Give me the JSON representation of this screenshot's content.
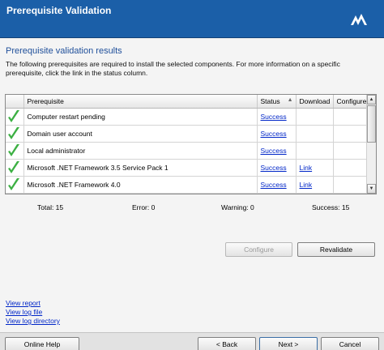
{
  "window": {
    "title": "Prerequisite Validation"
  },
  "section": {
    "title": "Prerequisite validation results",
    "description": "The following prerequisites are required to install the selected components.  For more information on a specific prerequisite, click the link in the status column."
  },
  "grid": {
    "columns": [
      "Prerequisite",
      "Status",
      "Download",
      "Configure"
    ],
    "rows": [
      {
        "name": "Computer restart pending",
        "status": "Success",
        "download": "",
        "configure": ""
      },
      {
        "name": "Domain user account",
        "status": "Success",
        "download": "",
        "configure": ""
      },
      {
        "name": "Local administrator",
        "status": "Success",
        "download": "",
        "configure": ""
      },
      {
        "name": "Microsoft .NET Framework 3.5 Service Pack 1",
        "status": "Success",
        "download": "Link",
        "configure": ""
      },
      {
        "name": "Microsoft .NET Framework 4.0",
        "status": "Success",
        "download": "Link",
        "configure": ""
      }
    ],
    "check_color": "#3cb043"
  },
  "summary": {
    "total": "Total: 15",
    "error": "Error: 0",
    "warning": "Warning: 0",
    "success": "Success: 15"
  },
  "actions": {
    "configure": "Configure",
    "revalidate": "Revalidate"
  },
  "links": {
    "view_report": "View report",
    "view_log_file": "View log file",
    "view_log_directory": "View log directory"
  },
  "footer": {
    "online_help": "Online Help",
    "back": "< Back",
    "next": "Next >",
    "cancel": "Cancel"
  },
  "colors": {
    "header": "#1b5fa8",
    "section_title": "#1f4f9a",
    "link": "#0026c8"
  }
}
